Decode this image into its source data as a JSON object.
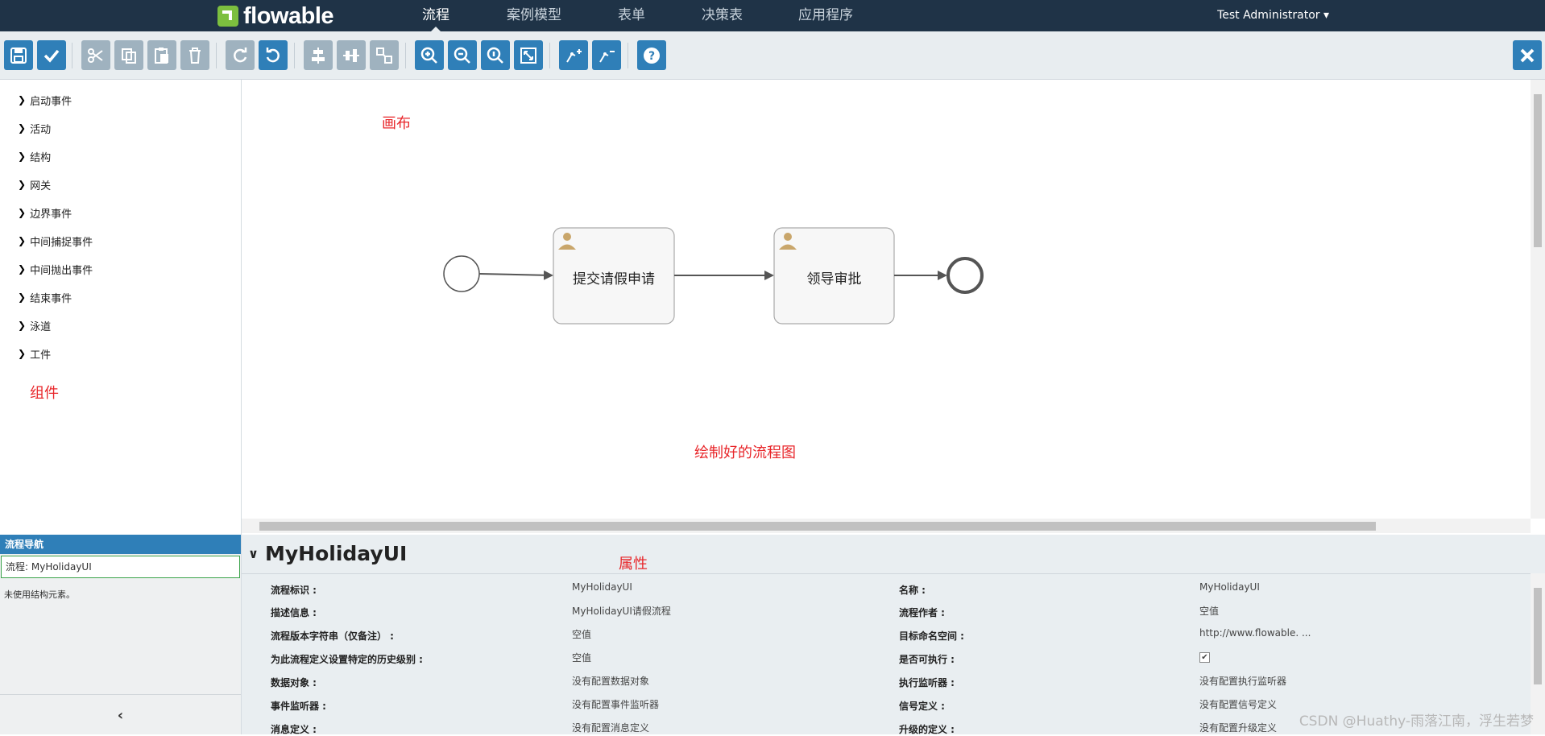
{
  "app": {
    "logo_text": "flowable"
  },
  "nav": {
    "items": [
      "流程",
      "案例模型",
      "表单",
      "决策表",
      "应用程序"
    ],
    "user": "Test Administrator ▾"
  },
  "toolbar": {
    "buttons": [
      "save-icon",
      "validate-icon",
      "cut-icon",
      "copy-icon",
      "paste-icon",
      "delete-icon",
      "redo-icon",
      "undo-icon",
      "align-horizontal-icon",
      "align-vertical-icon",
      "same-size-icon",
      "zoom-in-icon",
      "zoom-out-icon",
      "zoom-actual-icon",
      "zoom-fit-icon",
      "bend-add-icon",
      "bend-remove-icon",
      "help-icon",
      "close-icon"
    ]
  },
  "palette": {
    "items": [
      "启动事件",
      "活动",
      "结构",
      "网关",
      "边界事件",
      "中间捕捉事件",
      "中间抛出事件",
      "结束事件",
      "泳道",
      "工件"
    ],
    "annotation": "组件"
  },
  "canvas": {
    "annotation_canvas": "画布",
    "annotation_diagram": "绘制好的流程图",
    "task1": "提交请假申请",
    "task2": "领导审批"
  },
  "navigator": {
    "title": "流程导航",
    "process": "流程: MyHolidayUI",
    "message": "未使用结构元素。"
  },
  "properties": {
    "title": "MyHolidayUI",
    "annotation": "属性",
    "left": [
      {
        "label": "流程标识 :",
        "value": "MyHolidayUI"
      },
      {
        "label": "描述信息 :",
        "value": "MyHolidayUI请假流程"
      },
      {
        "label": "流程版本字符串（仅备注） :",
        "value": "空值"
      },
      {
        "label": "为此流程定义设置特定的历史级别 :",
        "value": "空值"
      },
      {
        "label": "数据对象 :",
        "value": "没有配置数据对象"
      },
      {
        "label": "事件监听器 :",
        "value": "没有配置事件监听器"
      },
      {
        "label": "消息定义 :",
        "value": "没有配置消息定义"
      }
    ],
    "right": [
      {
        "label": "名称 :",
        "value": "MyHolidayUI"
      },
      {
        "label": "流程作者 :",
        "value": "空值"
      },
      {
        "label": "目标命名空间 :",
        "value": "http://www.flowable. ..."
      },
      {
        "label": "是否可执行 :",
        "value": "✔"
      },
      {
        "label": "执行监听器 :",
        "value": "没有配置执行监听器"
      },
      {
        "label": "信号定义 :",
        "value": "没有配置信号定义"
      },
      {
        "label": "升级的定义 :",
        "value": "没有配置升级定义"
      }
    ]
  },
  "watermark": "CSDN @Huathy-雨落江南，浮生若梦"
}
